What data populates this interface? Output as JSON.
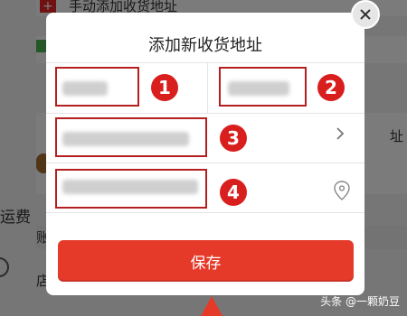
{
  "background": {
    "top_text": "手动添加收货地址",
    "top_icon": "plus-icon",
    "left_fragment": "运费",
    "row_labels": [
      "账",
      "店"
    ],
    "right_fragment": "址"
  },
  "modal": {
    "title": "添加新收货地址",
    "close_icon": "close-icon",
    "fields": [
      {
        "badge": "1"
      },
      {
        "badge": "2"
      },
      {
        "badge": "3",
        "trailing_icon": "chevron-right-icon"
      },
      {
        "badge": "4",
        "trailing_icon": "location-pin-icon"
      }
    ],
    "save_label": "保存",
    "accent_color": "#e53a2a",
    "badge_color": "#d91e1e"
  },
  "watermark": "头条 @一颗奶豆"
}
